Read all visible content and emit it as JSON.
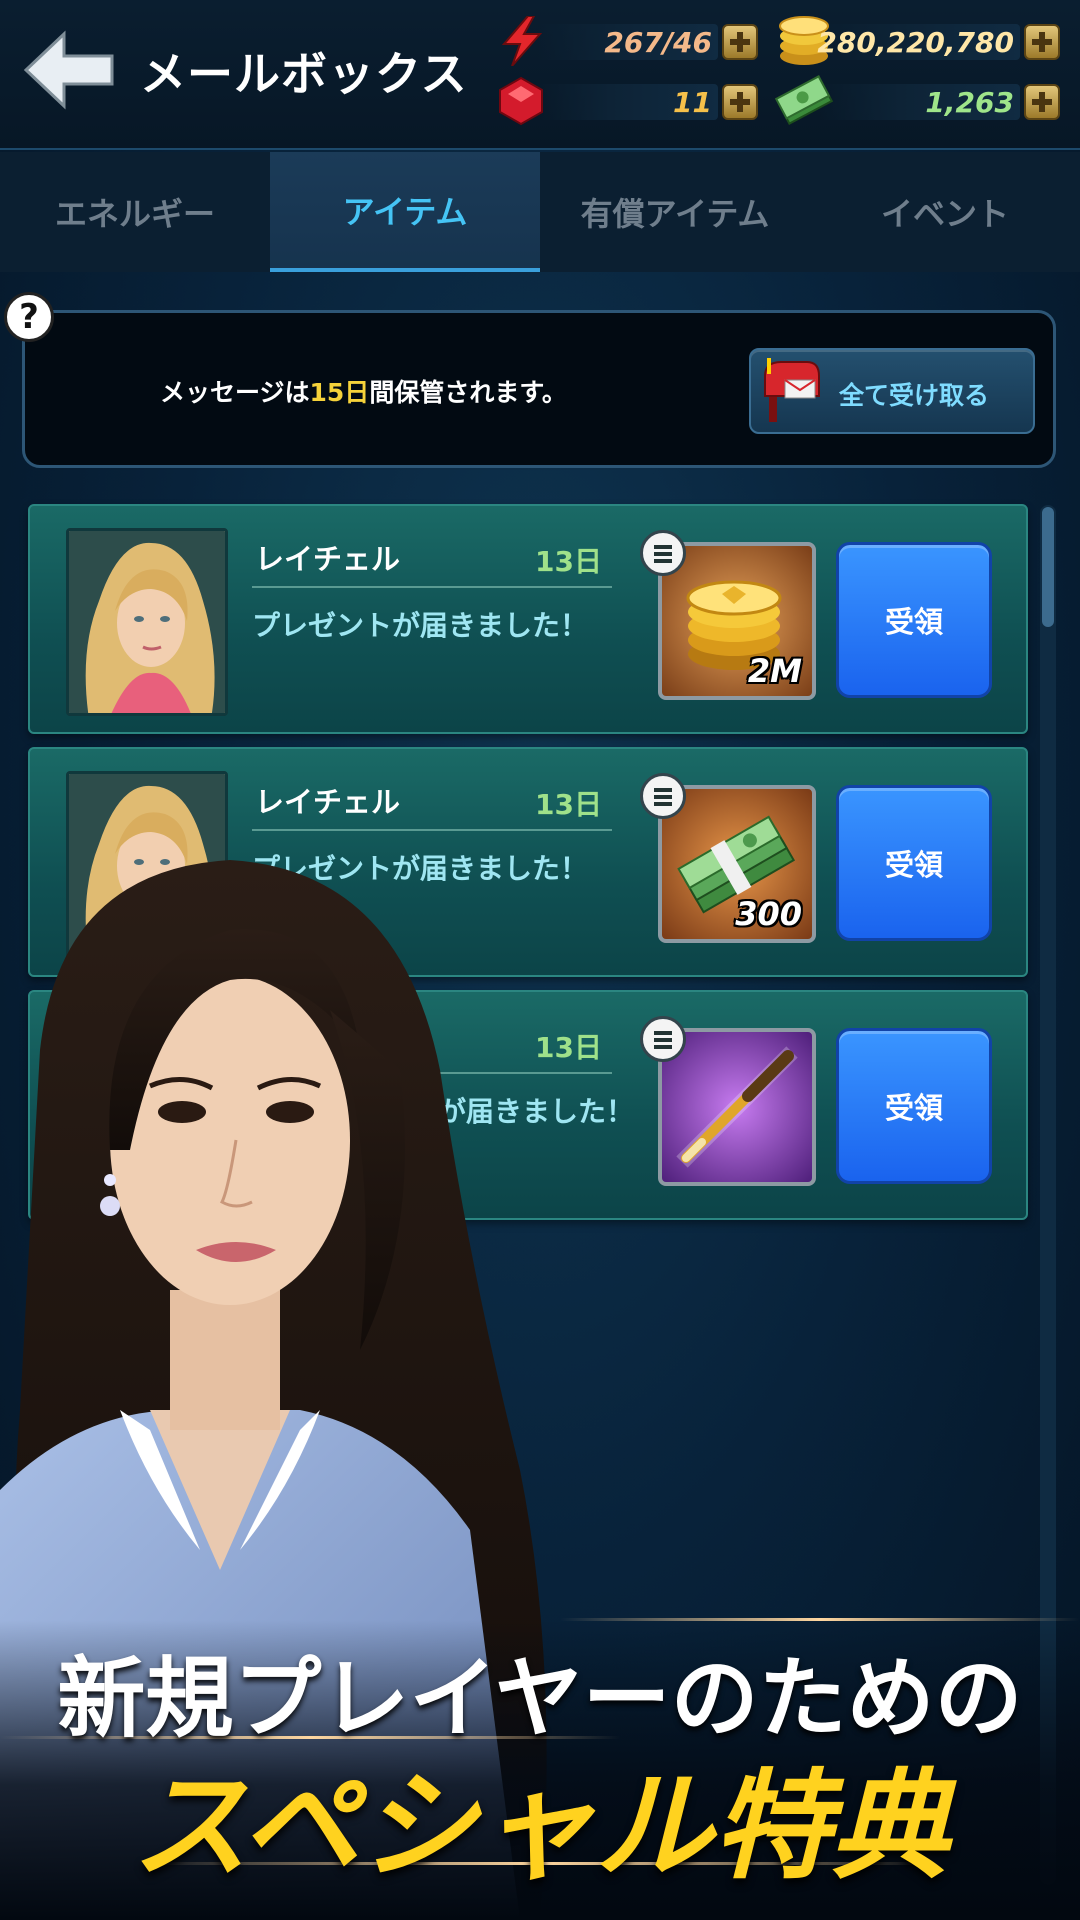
{
  "header": {
    "title": "メールボックス",
    "energy": "267/46",
    "gold": "280,220,780",
    "gems": "11",
    "cash": "1,263"
  },
  "tabs": [
    {
      "label": "エネルギー",
      "active": false
    },
    {
      "label": "アイテム",
      "active": true
    },
    {
      "label": "有償アイテム",
      "active": false
    },
    {
      "label": "イベント",
      "active": false
    }
  ],
  "notice": {
    "text_before": "メッセージは",
    "text_highlight": "15日",
    "text_after": "間保管されます。",
    "claim_all_label": "全て受け取る"
  },
  "mails": [
    {
      "sender": "レイチェル",
      "days": "13日",
      "message": "プレゼントが届きました！",
      "item": "gold-coins-icon",
      "quantity": "2M",
      "button": "受領"
    },
    {
      "sender": "レイチェル",
      "days": "13日",
      "message": "プレゼントが届きました！",
      "item": "cash-stack-icon",
      "quantity": "300",
      "button": "受領"
    },
    {
      "sender": "",
      "days": "13日",
      "message": "が届きました！",
      "item": "cue-stick-icon",
      "quantity": "",
      "button": "受領"
    }
  ],
  "promo": {
    "line1": "新規プレイヤーのための",
    "line2": "スペシャル特典"
  },
  "colors": {
    "accent_tab": "#45c4f5",
    "highlight": "#f5d23a",
    "receive_button": "#2a7cf8",
    "promo_yellow": "#ffd21f"
  }
}
